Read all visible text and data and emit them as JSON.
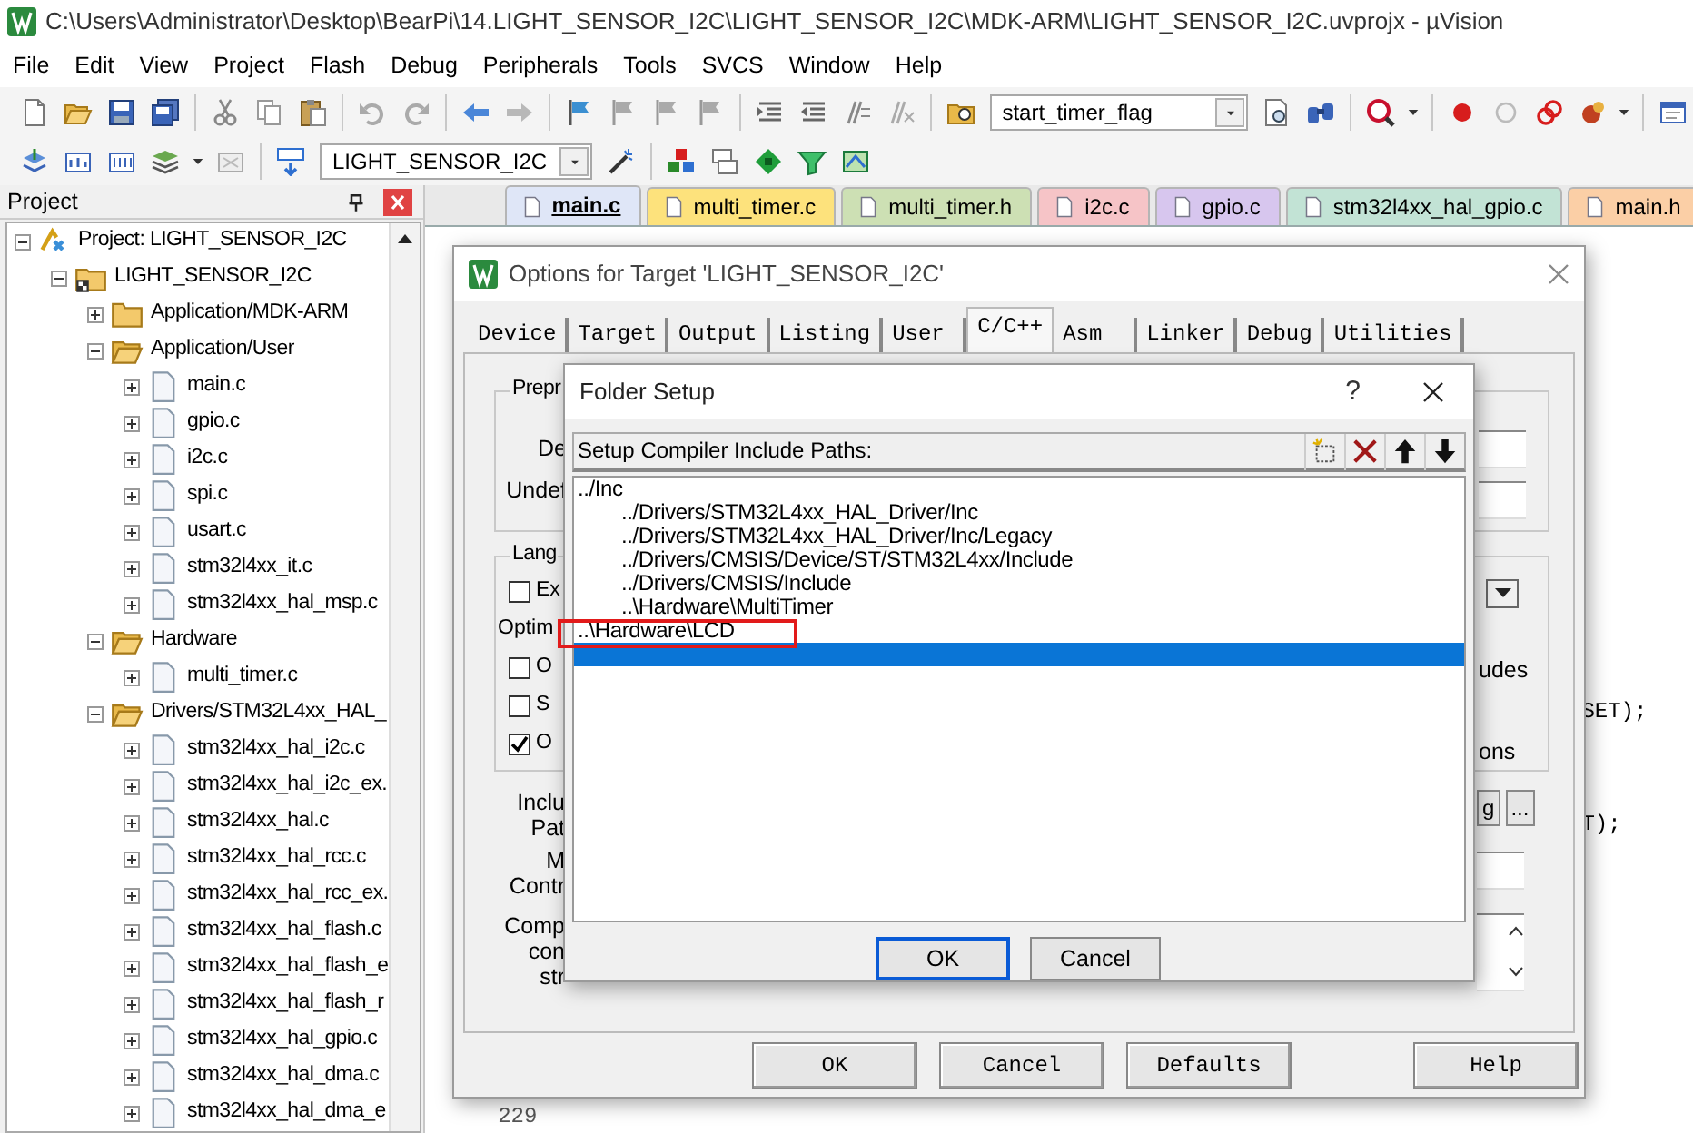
{
  "window": {
    "title": "C:\\Users\\Administrator\\Desktop\\BearPi\\14.LIGHT_SENSOR_I2C\\LIGHT_SENSOR_I2C\\MDK-ARM\\LIGHT_SENSOR_I2C.uvprojx - µVision"
  },
  "menu": [
    "File",
    "Edit",
    "View",
    "Project",
    "Flash",
    "Debug",
    "Peripherals",
    "Tools",
    "SVCS",
    "Window",
    "Help"
  ],
  "toolbar": {
    "find_combo": "start_timer_flag",
    "target_combo": "LIGHT_SENSOR_I2C"
  },
  "project_panel": {
    "title": "Project",
    "tree": [
      {
        "label": "Project: LIGHT_SENSOR_I2C",
        "kind": "project",
        "expanded": true,
        "children": [
          {
            "label": "LIGHT_SENSOR_I2C",
            "kind": "target",
            "expanded": true,
            "children": [
              {
                "label": "Application/MDK-ARM",
                "kind": "group",
                "expanded": false
              },
              {
                "label": "Application/User",
                "kind": "group",
                "expanded": true,
                "children": [
                  {
                    "label": "main.c",
                    "kind": "file",
                    "expanded": false
                  },
                  {
                    "label": "gpio.c",
                    "kind": "file",
                    "expanded": false
                  },
                  {
                    "label": "i2c.c",
                    "kind": "file",
                    "expanded": false
                  },
                  {
                    "label": "spi.c",
                    "kind": "file",
                    "expanded": false
                  },
                  {
                    "label": "usart.c",
                    "kind": "file",
                    "expanded": false
                  },
                  {
                    "label": "stm32l4xx_it.c",
                    "kind": "file",
                    "expanded": false
                  },
                  {
                    "label": "stm32l4xx_hal_msp.c",
                    "kind": "file",
                    "expanded": false
                  }
                ]
              },
              {
                "label": "Hardware",
                "kind": "group",
                "expanded": true,
                "children": [
                  {
                    "label": "multi_timer.c",
                    "kind": "file",
                    "expanded": false
                  }
                ]
              },
              {
                "label": "Drivers/STM32L4xx_HAL_",
                "kind": "group",
                "expanded": true,
                "children": [
                  {
                    "label": "stm32l4xx_hal_i2c.c",
                    "kind": "file",
                    "expanded": false
                  },
                  {
                    "label": "stm32l4xx_hal_i2c_ex.",
                    "kind": "file",
                    "expanded": false
                  },
                  {
                    "label": "stm32l4xx_hal.c",
                    "kind": "file",
                    "expanded": false
                  },
                  {
                    "label": "stm32l4xx_hal_rcc.c",
                    "kind": "file",
                    "expanded": false
                  },
                  {
                    "label": "stm32l4xx_hal_rcc_ex.",
                    "kind": "file",
                    "expanded": false
                  },
                  {
                    "label": "stm32l4xx_hal_flash.c",
                    "kind": "file",
                    "expanded": false
                  },
                  {
                    "label": "stm32l4xx_hal_flash_e",
                    "kind": "file",
                    "expanded": false
                  },
                  {
                    "label": "stm32l4xx_hal_flash_r",
                    "kind": "file",
                    "expanded": false
                  },
                  {
                    "label": "stm32l4xx_hal_gpio.c",
                    "kind": "file",
                    "expanded": false
                  },
                  {
                    "label": "stm32l4xx_hal_dma.c",
                    "kind": "file",
                    "expanded": false
                  },
                  {
                    "label": "stm32l4xx_hal_dma_e",
                    "kind": "file",
                    "expanded": false
                  }
                ]
              }
            ]
          }
        ]
      }
    ]
  },
  "editor": {
    "tabs": [
      {
        "label": "main.c",
        "color": "#dfe6f7",
        "selected": true
      },
      {
        "label": "multi_timer.c",
        "color": "#fde27c",
        "selected": false
      },
      {
        "label": "multi_timer.h",
        "color": "#cde0b4",
        "selected": false
      },
      {
        "label": "i2c.c",
        "color": "#f6c4c7",
        "selected": false
      },
      {
        "label": "gpio.c",
        "color": "#d7c6ee",
        "selected": false
      },
      {
        "label": "stm32l4xx_hal_gpio.c",
        "color": "#c2e3d5",
        "selected": false
      },
      {
        "label": "main.h",
        "color": "#fbcfa6",
        "selected": false
      }
    ],
    "code_fragments": [
      "SET);",
      "T);"
    ],
    "line_number": "229"
  },
  "options_dialog": {
    "title": "Options for Target 'LIGHT_SENSOR_I2C'",
    "tabs": [
      {
        "label": "Device",
        "selected": false
      },
      {
        "label": "Target",
        "selected": false
      },
      {
        "label": "Output",
        "selected": false
      },
      {
        "label": "Listing",
        "selected": false
      },
      {
        "label": "User",
        "selected": false
      },
      {
        "label": "C/C++",
        "selected": true
      },
      {
        "label": "Asm",
        "selected": false
      },
      {
        "label": "Linker",
        "selected": false
      },
      {
        "label": "Debug",
        "selected": false
      },
      {
        "label": "Utilities",
        "selected": false
      }
    ],
    "preprocessor_group": {
      "title": "Prepr",
      "labels": [
        "De",
        "Undef"
      ]
    },
    "language_group": {
      "title": "Lang",
      "items": [
        {
          "kind": "checkbox",
          "label": "Ex",
          "checked": false
        },
        {
          "kind": "label",
          "label": "Optim"
        },
        {
          "kind": "checkbox",
          "label": "O",
          "checked": false
        },
        {
          "kind": "checkbox",
          "label": "S",
          "checked": false
        },
        {
          "kind": "checkbox",
          "label": "O",
          "checked": true
        }
      ],
      "right_labels": [
        "udes",
        "ons"
      ]
    },
    "include_labels": [
      "Inclu",
      "Pat"
    ],
    "misc_labels": [
      "M",
      "Contr"
    ],
    "compiler_labels": [
      "Comp",
      "con",
      "str"
    ],
    "include_button": "g",
    "browse_button": "...",
    "buttons": [
      "OK",
      "Cancel",
      "Defaults",
      "Help"
    ]
  },
  "folder_dialog": {
    "title": "Folder Setup",
    "help": "?",
    "header": "Setup Compiler Include Paths:",
    "paths": [
      {
        "path": "../Inc",
        "selected": false,
        "children": [
          {
            "path": "../Drivers/STM32L4xx_HAL_Driver/Inc",
            "selected": false
          },
          {
            "path": "../Drivers/STM32L4xx_HAL_Driver/Inc/Legacy",
            "selected": false
          },
          {
            "path": "../Drivers/CMSIS/Device/ST/STM32L4xx/Include",
            "selected": false
          },
          {
            "path": "../Drivers/CMSIS/Include",
            "selected": false
          },
          {
            "path": "..\\Hardware\\MultiTimer",
            "selected": false
          }
        ]
      },
      {
        "path": "..\\Hardware\\LCD",
        "selected": false
      },
      {
        "selected": true
      }
    ],
    "buttons": [
      "OK",
      "Cancel"
    ]
  }
}
